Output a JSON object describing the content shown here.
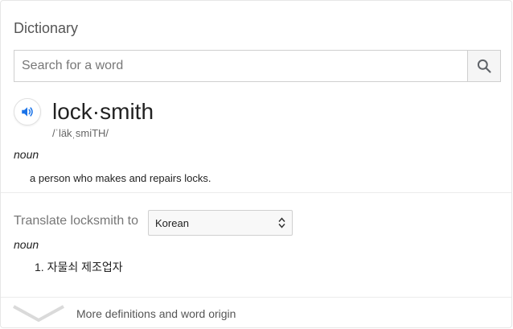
{
  "header": {
    "title": "Dictionary"
  },
  "search": {
    "placeholder": "Search for a word",
    "value": "",
    "button_icon": "search-icon"
  },
  "entry": {
    "speaker_icon": "speaker-icon",
    "word": "lock·smith",
    "phonetic": "/ˈläkˌsmiTH/",
    "part_of_speech": "noun",
    "definition": "a person who makes and repairs locks."
  },
  "translate": {
    "label": "Translate locksmith to",
    "language": "Korean",
    "part_of_speech": "noun",
    "items": [
      "1. 자물쇠 제조업자"
    ]
  },
  "footer": {
    "label": "More definitions and word origin",
    "icon": "chevron-down-icon"
  },
  "colors": {
    "accent": "#1a73e8",
    "border": "#cfcfcf",
    "muted_text": "#777777"
  }
}
